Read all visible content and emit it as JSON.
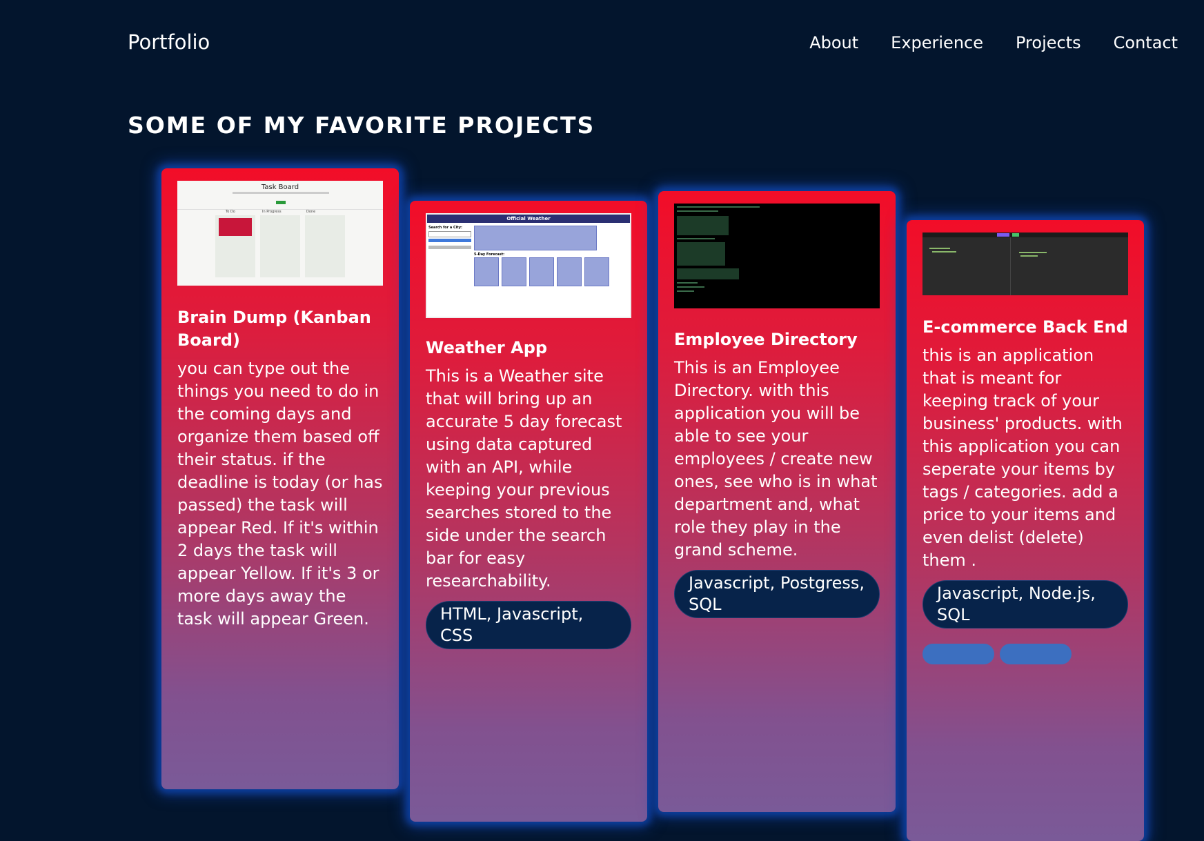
{
  "header": {
    "brand": "Portfolio",
    "nav": [
      "About",
      "Experience",
      "Projects",
      "Contact"
    ]
  },
  "section_title": "SOME OF MY FAVORITE PROJECTS",
  "projects": [
    {
      "title": "Brain Dump (Kanban Board)",
      "description": "you can type out the things you need to do in the coming days and organize them based off their status. if the deadline is today (or has passed) the task will appear Red. If it's within 2 days the task will appear Yellow. If it's 3 or more days away the task will appear Green.",
      "screenshot": {
        "title": "Task Board",
        "columns": [
          "To Do",
          "In Progress",
          "Done"
        ]
      }
    },
    {
      "title": "Weather App",
      "description": "This is a Weather site that will bring up an accurate 5 day forecast using data captured with an API, while keeping your previous searches stored to the side under the search bar for easy researchability.",
      "tags": "HTML, Javascript, CSS",
      "screenshot": {
        "header": "Official Weather",
        "search_label": "Search for a City:",
        "forecast_label": "5-Day Forecast:"
      }
    },
    {
      "title": "Employee Directory",
      "description": "This is an Employee Directory. with this application you will be able to see your employees / create new ones, see who is in what department and, what role they play in the grand scheme.",
      "tags": "Javascript, Postgress, SQL"
    },
    {
      "title": "E-commerce Back End",
      "description": "this is an application that is meant for keeping track of your business' products. with this application you can seperate your items by tags / categories. add a price to your items and even delist (delete) them .",
      "tags": "Javascript, Node.js, SQL"
    }
  ],
  "colors": {
    "background": "#03152d",
    "card_top": "#f20d28",
    "card_bottom": "#7a5a98",
    "card_glow": "#0c3e9c",
    "tag_pill": "#07234a"
  }
}
